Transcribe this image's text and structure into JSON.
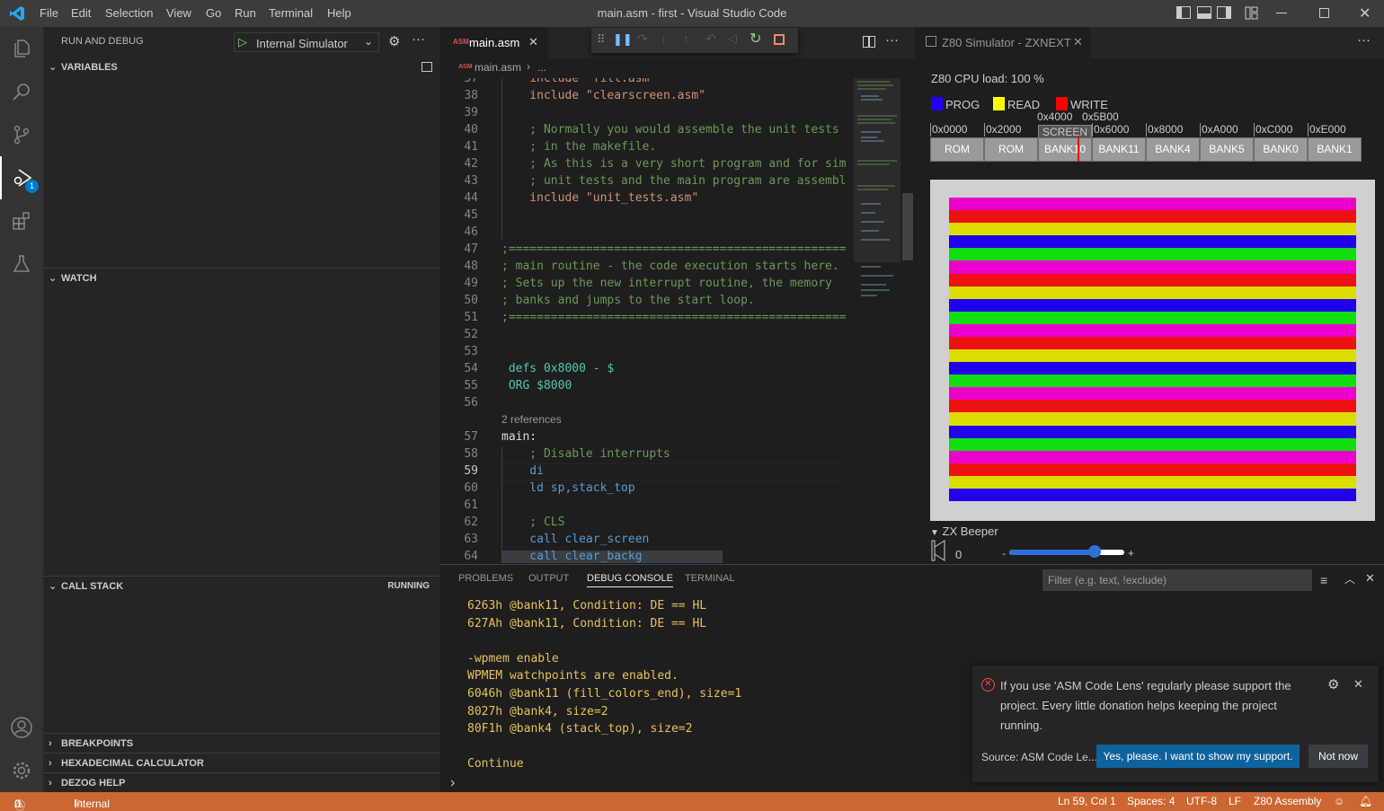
{
  "window": {
    "title": "main.asm - first - Visual Studio Code",
    "menu": [
      "File",
      "Edit",
      "Selection",
      "View",
      "Go",
      "Run",
      "Terminal",
      "Help"
    ]
  },
  "activity": {
    "debug_badge": "1"
  },
  "sidebar": {
    "title": "RUN AND DEBUG",
    "config": "Internal Simulator",
    "variables": "VARIABLES",
    "watch": "WATCH",
    "call_stack": "CALL STACK",
    "call_stack_status": "RUNNING",
    "breakpoints": "BREAKPOINTS",
    "hex_calc": "HEXADECIMAL CALCULATOR",
    "dezog_help": "DEZOG HELP"
  },
  "editor": {
    "tab_icon": "ASM",
    "tab_label": "main.asm",
    "breadcrumb_file": "main.asm",
    "breadcrumb_rest": "...",
    "codelens": "2 references",
    "lines": [
      {
        "n": "37",
        "text": "    include \"fill.asm\""
      },
      {
        "n": "38",
        "text": "    include \"clearscreen.asm\""
      },
      {
        "n": "39",
        "text": ""
      },
      {
        "n": "40",
        "text": "    ; Normally you would assemble the unit tests i"
      },
      {
        "n": "41",
        "text": "    ; in the makefile."
      },
      {
        "n": "42",
        "text": "    ; As this is a very short program and for simp"
      },
      {
        "n": "43",
        "text": "    ; unit tests and the main program are assemble"
      },
      {
        "n": "44",
        "text": "    include \"unit_tests.asm\""
      },
      {
        "n": "45",
        "text": ""
      },
      {
        "n": "46",
        "text": ""
      },
      {
        "n": "47",
        "text": ";=================================================="
      },
      {
        "n": "48",
        "text": "; main routine - the code execution starts here."
      },
      {
        "n": "49",
        "text": "; Sets up the new interrupt routine, the memory"
      },
      {
        "n": "50",
        "text": "; banks and jumps to the start loop."
      },
      {
        "n": "51",
        "text": ";=================================================="
      },
      {
        "n": "52",
        "text": ""
      },
      {
        "n": "53",
        "text": ""
      },
      {
        "n": "54",
        "text": " defs 0x8000 - $"
      },
      {
        "n": "55",
        "text": " ORG $8000"
      },
      {
        "n": "56",
        "text": ""
      },
      {
        "n": "57",
        "text": "main:"
      },
      {
        "n": "58",
        "text": "    ; Disable interrupts"
      },
      {
        "n": "59",
        "text": "    di"
      },
      {
        "n": "60",
        "text": "    ld sp,stack_top"
      },
      {
        "n": "61",
        "text": ""
      },
      {
        "n": "62",
        "text": "    ; CLS"
      },
      {
        "n": "63",
        "text": "    call clear_screen"
      },
      {
        "n": "64",
        "text": "    call clear_backg"
      }
    ]
  },
  "simulator": {
    "tab_label": "Z80 Simulator - ZXNEXT",
    "cpu_load": "Z80 CPU load: 100 %",
    "legend": [
      {
        "label": "PROG",
        "color": "#2200ff"
      },
      {
        "label": "READ",
        "color": "#ffff00"
      },
      {
        "label": "WRITE",
        "color": "#ff0000"
      }
    ],
    "addresses_top": [
      "0x4000",
      "0x5B00"
    ],
    "addresses": [
      "0x0000",
      "0x2000",
      "SCREEN",
      "0x6000",
      "0x8000",
      "0xA000",
      "0xC000",
      "0xE000"
    ],
    "banks": [
      "ROM",
      "ROM",
      "BANK10",
      "BANK11",
      "BANK4",
      "BANK5",
      "BANK0",
      "BANK1"
    ],
    "stripe_colors": [
      "#ee00cc",
      "#ee1111",
      "#dddd00",
      "#2200ee",
      "#11dd11"
    ],
    "beeper_label": "ZX Beeper",
    "beeper_value": "0",
    "volume_minus": "-",
    "volume_plus": "+",
    "volume_level": 0.74
  },
  "panel": {
    "tabs": [
      "PROBLEMS",
      "OUTPUT",
      "DEBUG CONSOLE",
      "TERMINAL"
    ],
    "active_tab": 2,
    "filter_placeholder": "Filter (e.g. text, !exclude)",
    "console": [
      "6263h @bank11, Condition: DE == HL",
      "627Ah @bank11, Condition: DE == HL",
      "",
      "-wpmem enable",
      "WPMEM watchpoints are enabled.",
      "6046h @bank11 (fill_colors_end), size=1",
      "8027h @bank4, size=2",
      "80F1h @bank4 (stack_top), size=2",
      "",
      "Continue"
    ]
  },
  "notification": {
    "message": "If you use 'ASM Code Lens' regularly please support the project. Every little donation helps keeping the project running.",
    "source": "Source: ASM Code Le...",
    "primary": "Yes, please. I want to show my support.",
    "secondary": "Not now"
  },
  "status": {
    "errors": "0",
    "warnings": "0",
    "debug": "Internal Simulator (first)",
    "position": "Ln 59, Col 1",
    "spaces": "Spaces: 4",
    "encoding": "UTF-8",
    "eol": "LF",
    "language": "Z80 Assembly"
  }
}
